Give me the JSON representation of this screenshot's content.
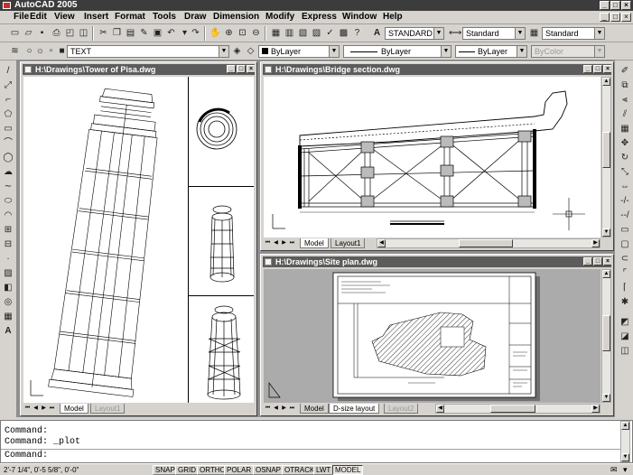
{
  "app": {
    "title": "AutoCAD 2005"
  },
  "menus": [
    "File",
    "Edit",
    "View",
    "Insert",
    "Format",
    "Tools",
    "Draw",
    "Dimension",
    "Modify",
    "Express",
    "Window",
    "Help"
  ],
  "toolbar": {
    "text_style": "STANDARD",
    "dim_style": "Standard",
    "table_style": "Standard",
    "plot_style": "Standard",
    "layer": "TEXT",
    "color": "ByLayer",
    "linetype": "ByLayer",
    "lineweight": "ByLayer",
    "plotstyle_color": "ByColor"
  },
  "windows": {
    "pisa": {
      "title": "H:\\Drawings\\Tower of Pisa.dwg",
      "tabs": [
        "Model",
        "Layout1"
      ]
    },
    "bridge": {
      "title": "H:\\Drawings\\Bridge section.dwg",
      "tabs": [
        "Model",
        "Layout1"
      ]
    },
    "site": {
      "title": "H:\\Drawings\\Site plan.dwg",
      "tabs": [
        "Model",
        "D-size layout",
        "Layout2"
      ]
    }
  },
  "command": {
    "lines": [
      "Command:",
      "Command: _plot",
      "Command:"
    ]
  },
  "status": {
    "coords": "2'-7 1/4\", 0'-5 5/8\", 0'-0\"",
    "buttons": [
      {
        "label": "SNAP",
        "on": false
      },
      {
        "label": "GRID",
        "on": false
      },
      {
        "label": "ORTHO",
        "on": false
      },
      {
        "label": "POLAR",
        "on": false
      },
      {
        "label": "OSNAP",
        "on": false
      },
      {
        "label": "OTRACK",
        "on": false
      },
      {
        "label": "LWT",
        "on": false
      },
      {
        "label": "MODEL",
        "on": true
      }
    ]
  }
}
